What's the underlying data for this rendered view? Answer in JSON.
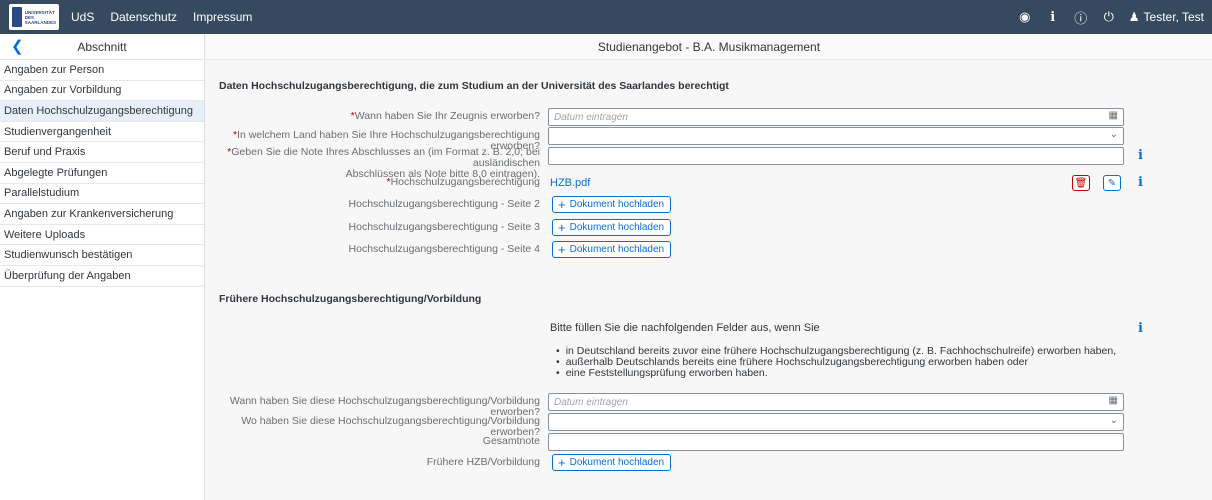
{
  "topbar": {
    "logo_text": [
      "UNIVERSITÄT",
      "DES",
      "SAARLANDES"
    ],
    "links": [
      "UdS",
      "Datenschutz",
      "Impressum"
    ],
    "user": "Tester, Test"
  },
  "sidebar": {
    "title": "Abschnitt",
    "items": [
      "Angaben zur Person",
      "Angaben zur Vorbildung",
      "Daten Hochschulzugangsberechtigung",
      "Studienvergangenheit",
      "Beruf und Praxis",
      "Abgelegte Prüfungen",
      "Parallelstudium",
      "Angaben zur Krankenversicherung",
      "Weitere Uploads",
      "Studienwunsch bestätigen",
      "Überprüfung der Angaben"
    ]
  },
  "main": {
    "title": "Studienangebot - B.A. Musikmanagement",
    "section1": {
      "title": "Daten Hochschulzugangsberechtigung, die zum Studium an der Universität des Saarlandes berechtigt",
      "date_label": "Wann haben Sie Ihr Zeugnis erworben?",
      "date_placeholder": "Datum eintragen",
      "country_label": "In welchem Land haben Sie Ihre Hochschulzugangsberechtigung erworben?",
      "grade_label_1": "Geben Sie die Note Ihres Abschlusses an (im Format z. B. 2,0; bei ausländischen",
      "grade_label_2": "Abschlüssen als Note bitte 8,0 eintragen).",
      "hzb_label": "Hochschulzugangsberechtigung",
      "hzb_file": "HZB.pdf",
      "page2_label": "Hochschulzugangsberechtigung - Seite 2",
      "page3_label": "Hochschulzugangsberechtigung - Seite 3",
      "page4_label": "Hochschulzugangsberechtigung - Seite 4",
      "upload_label": "Dokument hochladen"
    },
    "section2": {
      "title": "Frühere Hochschulzugangsberechtigung/Vorbildung",
      "intro": "Bitte füllen Sie die nachfolgenden Felder aus, wenn Sie",
      "bullets": [
        "in Deutschland bereits zuvor eine frühere Hochschulzugangsberechtigung (z. B. Fachhochschulreife) erworben haben,",
        "außerhalb Deutschlands bereits eine frühere Hochschulzugangsberechtigung erworben haben oder",
        "eine Feststellungsprüfung erworben haben."
      ],
      "when_label": "Wann haben Sie diese Hochschulzugangsberechtigung/Vorbildung erworben?",
      "when_placeholder": "Datum eintragen",
      "where_label": "Wo haben Sie diese Hochschulzugangsberechtigung/Vorbildung erworben?",
      "grade_label": "Gesamtnote",
      "doc_label": "Frühere HZB/Vorbildung",
      "upload_label": "Dokument hochladen"
    }
  },
  "colors": {
    "shell": "#354a5f",
    "accent": "#0a6ed1",
    "required": "#bb0000",
    "selected": "#e5f0fa"
  }
}
